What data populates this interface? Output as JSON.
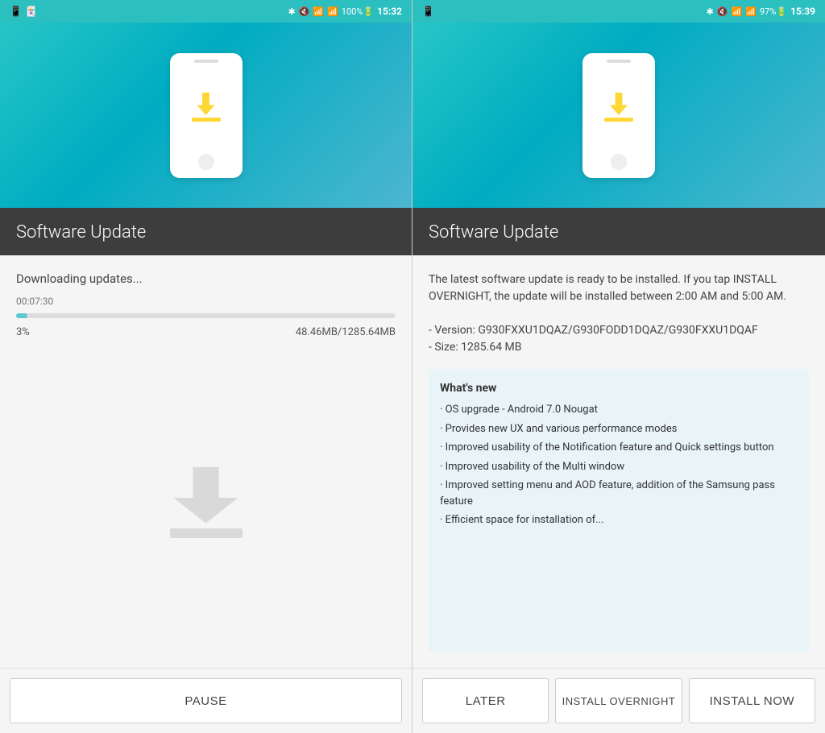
{
  "left": {
    "statusBar": {
      "leftIcons": "📱 🔊",
      "bluetooth": "✦",
      "signal": "📶",
      "battery": "100%🔋",
      "time": "15:32"
    },
    "header": {
      "phoneAlt": "phone with download icon"
    },
    "titleSection": {
      "title": "Software Update"
    },
    "content": {
      "statusText": "Downloading updates...",
      "timer": "00:07:30",
      "progressPercent": 3,
      "progressWidth": "3%",
      "progressLabel": "3%",
      "progressSize": "48.46MB/1285.64MB"
    },
    "footer": {
      "pauseLabel": "PAUSE"
    }
  },
  "right": {
    "statusBar": {
      "leftIcons": "📱",
      "bluetooth": "✦",
      "signal": "📶",
      "battery": "97%🔋",
      "time": "15:39"
    },
    "header": {
      "phoneAlt": "phone with download icon"
    },
    "titleSection": {
      "title": "Software Update"
    },
    "content": {
      "description": "The latest software update is ready to be installed. If you tap INSTALL OVERNIGHT, the update will be installed between 2:00 AM and 5:00 AM.\n · Version: G930FXXU1DQAZ/G930FODD1DQAZ/G930FXXU1DQAF\n · Size: 1285.64 MB",
      "descLine1": "The latest software update is ready to be installed. If you tap INSTALL OVERNIGHT, the update will be installed between 2:00 AM and 5:00 AM.",
      "descVersion": "- Version: G930FXXU1DQAZ/G930FODD1DQAZ/G930FXXU1DQAF",
      "descSize": "- Size: 1285.64 MB",
      "whatsNew": {
        "title": "What's new",
        "items": [
          "· OS upgrade - Android 7.0 Nougat",
          "· Provides new UX and various performance modes",
          "· Improved usability of the Notification feature and Quick settings button",
          "· Improved usability of the Multi window",
          "· Improved setting menu and AOD feature, addition of the Samsung pass feature",
          "· Efficient space for installation of..."
        ]
      }
    },
    "footer": {
      "laterLabel": "LATER",
      "overnightLabel": "INSTALL OVERNIGHT",
      "installNowLabel": "INSTALL NOW"
    }
  }
}
